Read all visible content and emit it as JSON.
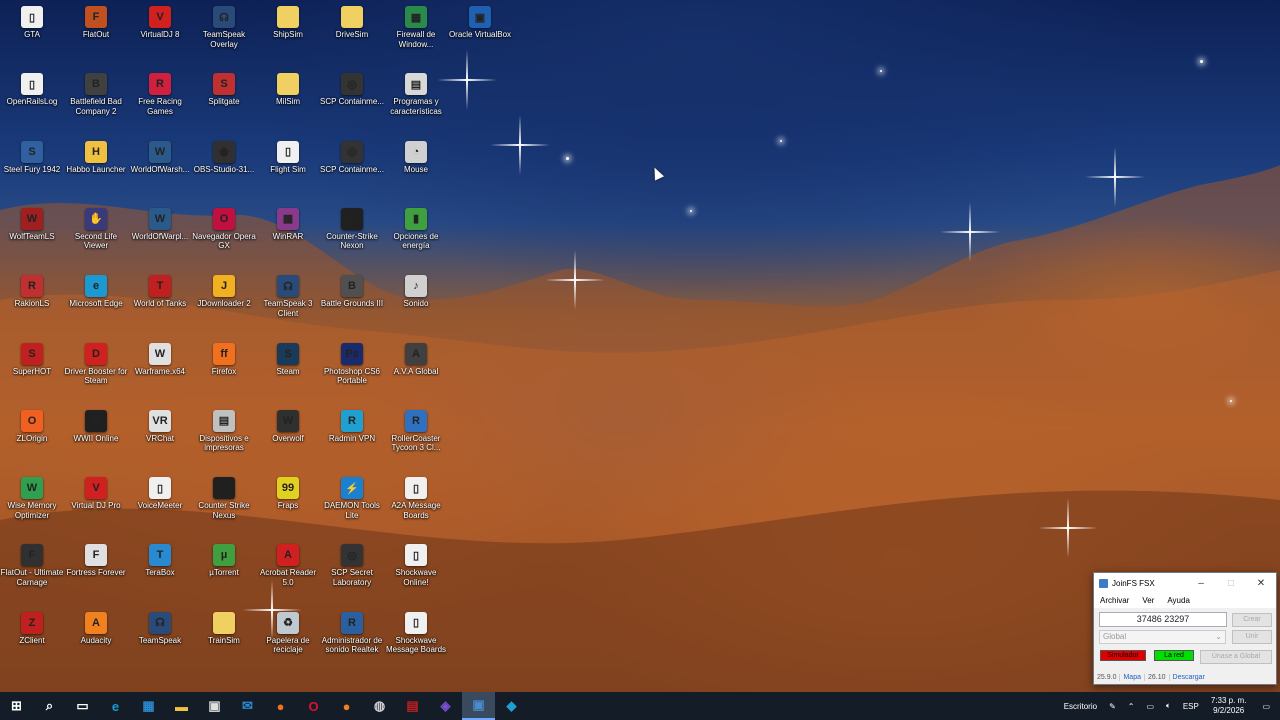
{
  "desktop": {
    "icons": [
      {
        "label": "GTA",
        "icon": "file-icon",
        "color": "#f0f0f0",
        "glyph": "▯"
      },
      {
        "label": "FlatOut",
        "icon": "game-icon",
        "color": "#c05020",
        "glyph": "F"
      },
      {
        "label": "VirtualDJ 8",
        "icon": "dj-icon",
        "color": "#d02020",
        "glyph": "V"
      },
      {
        "label": "TeamSpeak Overlay",
        "icon": "headset-icon",
        "color": "#2a4a7a",
        "glyph": "☊"
      },
      {
        "label": "ShipSim",
        "icon": "folder-icon",
        "color": "#f0d060",
        "glyph": ""
      },
      {
        "label": "DriveSim",
        "icon": "folder-icon",
        "color": "#f0d060",
        "glyph": ""
      },
      {
        "label": "Firewall de Window...",
        "icon": "firewall-icon",
        "color": "#2a8a4a",
        "glyph": "▦"
      },
      {
        "label": "Oracle VirtualBox",
        "icon": "virtualbox-icon",
        "color": "#2060b0",
        "glyph": "▣"
      },
      {
        "label": "OpenRailsLog",
        "icon": "file-icon",
        "color": "#f0f0f0",
        "glyph": "▯"
      },
      {
        "label": "Battlefield Bad Company 2",
        "icon": "game-icon",
        "color": "#404040",
        "glyph": "B"
      },
      {
        "label": "Free Racing Games",
        "icon": "racing-icon",
        "color": "#d02040",
        "glyph": "R"
      },
      {
        "label": "Splitgate",
        "icon": "game-icon",
        "color": "#c03030",
        "glyph": "S"
      },
      {
        "label": "MilSim",
        "icon": "folder-icon",
        "color": "#f0d060",
        "glyph": ""
      },
      {
        "label": "SCP Containme...",
        "icon": "scp-icon",
        "color": "#333333",
        "glyph": "◎"
      },
      {
        "label": "Programas y características",
        "icon": "programs-icon",
        "color": "#d8d8d8",
        "glyph": "▤"
      },
      {
        "label": "Steel Fury 1942",
        "icon": "game-icon",
        "color": "#3060a0",
        "glyph": "S"
      },
      {
        "label": "Habbo Launcher",
        "icon": "habbo-icon",
        "color": "#f0c040",
        "glyph": "H"
      },
      {
        "label": "WorldOfWarsh...",
        "icon": "game-icon",
        "color": "#2a5a8a",
        "glyph": "W"
      },
      {
        "label": "OBS-Studio-31...",
        "icon": "obs-icon",
        "color": "#303030",
        "glyph": "◉"
      },
      {
        "label": "Flight Sim",
        "icon": "file-icon",
        "color": "#f0f0f0",
        "glyph": "▯"
      },
      {
        "label": "SCP Containme...",
        "icon": "scp-icon",
        "color": "#333333",
        "glyph": "◎"
      },
      {
        "label": "Mouse",
        "icon": "mouse-icon",
        "color": "#d0d0d0",
        "glyph": "◔"
      },
      {
        "label": "WolfTeamLS",
        "icon": "game-icon",
        "color": "#a02020",
        "glyph": "W"
      },
      {
        "label": "Second Life Viewer",
        "icon": "game-icon",
        "color": "#3a3a7a",
        "glyph": "✋"
      },
      {
        "label": "WorldOfWarpl...",
        "icon": "game-icon",
        "color": "#2a5a8a",
        "glyph": "W"
      },
      {
        "label": "Navegador Opera GX",
        "icon": "opera-icon",
        "color": "#c01040",
        "glyph": "O"
      },
      {
        "label": "WinRAR",
        "icon": "winrar-icon",
        "color": "#8a3a8a",
        "glyph": "▦"
      },
      {
        "label": "Counter-Strike Nexon",
        "icon": "game-icon",
        "color": "#202020",
        "glyph": "C"
      },
      {
        "label": "Opciones de energía",
        "icon": "battery-icon",
        "color": "#40a040",
        "glyph": "▮"
      },
      {
        "label": "RakionLS",
        "icon": "game-icon",
        "color": "#c03030",
        "glyph": "R"
      },
      {
        "label": "Microsoft Edge",
        "icon": "edge-icon",
        "color": "#1a9ad0",
        "glyph": "e"
      },
      {
        "label": "World of Tanks",
        "icon": "game-icon",
        "color": "#c02020",
        "glyph": "T"
      },
      {
        "label": "JDownloader 2",
        "icon": "download-icon",
        "color": "#f0b020",
        "glyph": "J"
      },
      {
        "label": "TeamSpeak 3 Client",
        "icon": "headset-icon",
        "color": "#2a4a7a",
        "glyph": "☊"
      },
      {
        "label": "Battle Grounds III",
        "icon": "game-icon",
        "color": "#505050",
        "glyph": "B"
      },
      {
        "label": "Sonido",
        "icon": "speaker-icon",
        "color": "#d0d0d0",
        "glyph": "♪"
      },
      {
        "label": "SuperHOT",
        "icon": "game-icon",
        "color": "#c02020",
        "glyph": "S"
      },
      {
        "label": "Driver Booster for Steam",
        "icon": "booster-icon",
        "color": "#d02020",
        "glyph": "D"
      },
      {
        "label": "Warframe.x64",
        "icon": "game-icon",
        "color": "#e0e0e0",
        "glyph": "W"
      },
      {
        "label": "Firefox",
        "icon": "firefox-icon",
        "color": "#f07020",
        "glyph": "ff"
      },
      {
        "label": "Steam",
        "icon": "steam-icon",
        "color": "#1a3a5a",
        "glyph": "S"
      },
      {
        "label": "Photoshop CS6 Portable",
        "icon": "photoshop-icon",
        "color": "#1a2a6a",
        "glyph": "Ps"
      },
      {
        "label": "A.V.A Global",
        "icon": "game-icon",
        "color": "#404040",
        "glyph": "A"
      },
      {
        "label": "ZLOrigin",
        "icon": "origin-icon",
        "color": "#f06020",
        "glyph": "O"
      },
      {
        "label": "WWII Online",
        "icon": "game-icon",
        "color": "#202020",
        "glyph": "W"
      },
      {
        "label": "VRChat",
        "icon": "vrchat-icon",
        "color": "#e0e0e0",
        "glyph": "VR"
      },
      {
        "label": "Dispositivos e impresoras",
        "icon": "printer-icon",
        "color": "#c0c0c0",
        "glyph": "▤"
      },
      {
        "label": "Overwolf",
        "icon": "overwolf-icon",
        "color": "#303030",
        "glyph": "W"
      },
      {
        "label": "Radmin VPN",
        "icon": "vpn-icon",
        "color": "#20a0d0",
        "glyph": "R"
      },
      {
        "label": "RollerCoaster Tycoon 3 Cl...",
        "icon": "game-icon",
        "color": "#3070c0",
        "glyph": "R"
      },
      {
        "label": "Wise Memory Optimizer",
        "icon": "memory-icon",
        "color": "#30a050",
        "glyph": "W"
      },
      {
        "label": "Virtual DJ Pro",
        "icon": "dj-icon",
        "color": "#d02020",
        "glyph": "V"
      },
      {
        "label": "VoiceMeeter",
        "icon": "file-icon",
        "color": "#f0f0f0",
        "glyph": "▯"
      },
      {
        "label": "Counter Strike Nexus",
        "icon": "game-icon",
        "color": "#202020",
        "glyph": "C"
      },
      {
        "label": "Fraps",
        "icon": "fraps-icon",
        "color": "#e0d020",
        "glyph": "99"
      },
      {
        "label": "DAEMON Tools Lite",
        "icon": "daemon-icon",
        "color": "#1a80d0",
        "glyph": "⚡"
      },
      {
        "label": "A2A Message Boards",
        "icon": "file-icon",
        "color": "#f0f0f0",
        "glyph": "▯"
      },
      {
        "label": "FlatOut - Ultimate Carnage",
        "icon": "game-icon",
        "color": "#303030",
        "glyph": "F"
      },
      {
        "label": "Fortress Forever",
        "icon": "game-icon",
        "color": "#e0e0e0",
        "glyph": "F"
      },
      {
        "label": "TeraBox",
        "icon": "terabox-icon",
        "color": "#2a8ad0",
        "glyph": "T"
      },
      {
        "label": "µTorrent",
        "icon": "torrent-icon",
        "color": "#40a040",
        "glyph": "µ"
      },
      {
        "label": "Acrobat Reader 5.0",
        "icon": "acrobat-icon",
        "color": "#d02020",
        "glyph": "A"
      },
      {
        "label": "SCP Secret Laboratory",
        "icon": "scp-icon",
        "color": "#333333",
        "glyph": "◎"
      },
      {
        "label": "Shockwave Online!",
        "icon": "file-icon",
        "color": "#f0f0f0",
        "glyph": "▯"
      },
      {
        "label": "ZClient",
        "icon": "game-icon",
        "color": "#c02020",
        "glyph": "Z"
      },
      {
        "label": "Audacity",
        "icon": "audacity-icon",
        "color": "#f08020",
        "glyph": "A"
      },
      {
        "label": "TeamSpeak",
        "icon": "headset-icon",
        "color": "#2a4a7a",
        "glyph": "☊"
      },
      {
        "label": "TrainSim",
        "icon": "folder-icon",
        "color": "#f0d060",
        "glyph": ""
      },
      {
        "label": "Papelera de reciclaje",
        "icon": "recycle-bin-icon",
        "color": "#c0c8d0",
        "glyph": "♻"
      },
      {
        "label": "Administrador de sonido Realtek",
        "icon": "realtek-icon",
        "color": "#2a60a0",
        "glyph": "R"
      },
      {
        "label": "Shockwave Message Boards",
        "icon": "file-icon",
        "color": "#f0f0f0",
        "glyph": "▯"
      }
    ]
  },
  "joinfs": {
    "title": "JoinFS FSX",
    "menu": [
      "Archivar",
      "Ver",
      "Ayuda"
    ],
    "code_value": "37486 23297",
    "create_label": "Crear",
    "network_value": "Global",
    "join_label": "Unir",
    "simulator_label": "Simulador",
    "network_status_label": "La red",
    "join_global_label": "Únase a Global",
    "footer": {
      "version_left": "25.9.0",
      "map_link": "Mapa",
      "version_right": "26.10",
      "download_link": "Descargar"
    },
    "colors": {
      "simulator": "#e00000",
      "network": "#00e000"
    }
  },
  "taskbar": {
    "apps": [
      {
        "name": "start-button",
        "glyph": "⊞",
        "color": "#ffffff"
      },
      {
        "name": "search-icon",
        "glyph": "⌕",
        "color": "#ffffff"
      },
      {
        "name": "task-view-icon",
        "glyph": "▭",
        "color": "#ffffff"
      },
      {
        "name": "edge-icon",
        "glyph": "e",
        "color": "#1a9ad0"
      },
      {
        "name": "store-icon",
        "glyph": "▦",
        "color": "#2a8ad0"
      },
      {
        "name": "file-explorer-icon",
        "glyph": "▬",
        "color": "#f0c040"
      },
      {
        "name": "shopping-bag-icon",
        "glyph": "▣",
        "color": "#e0e0e0"
      },
      {
        "name": "mail-icon",
        "glyph": "✉",
        "color": "#2a8ad0"
      },
      {
        "name": "firefox-icon",
        "glyph": "●",
        "color": "#f07020"
      },
      {
        "name": "opera-icon",
        "glyph": "O",
        "color": "#e01030"
      },
      {
        "name": "orange-app-icon",
        "glyph": "●",
        "color": "#f08020"
      },
      {
        "name": "network-app-icon",
        "glyph": "◍",
        "color": "#d0d0d0"
      },
      {
        "name": "calendar-app-icon",
        "glyph": "▤",
        "color": "#c02020"
      },
      {
        "name": "viber-icon",
        "glyph": "◈",
        "color": "#7a50d0"
      },
      {
        "name": "joinfs-icon",
        "glyph": "▣",
        "color": "#4a8ad0"
      },
      {
        "name": "vscode-icon",
        "glyph": "◆",
        "color": "#20a0d0"
      }
    ],
    "desktop_label": "Escritorio",
    "language": "ESP",
    "time": "7:33 p. m.",
    "date": "9/2/2026"
  }
}
